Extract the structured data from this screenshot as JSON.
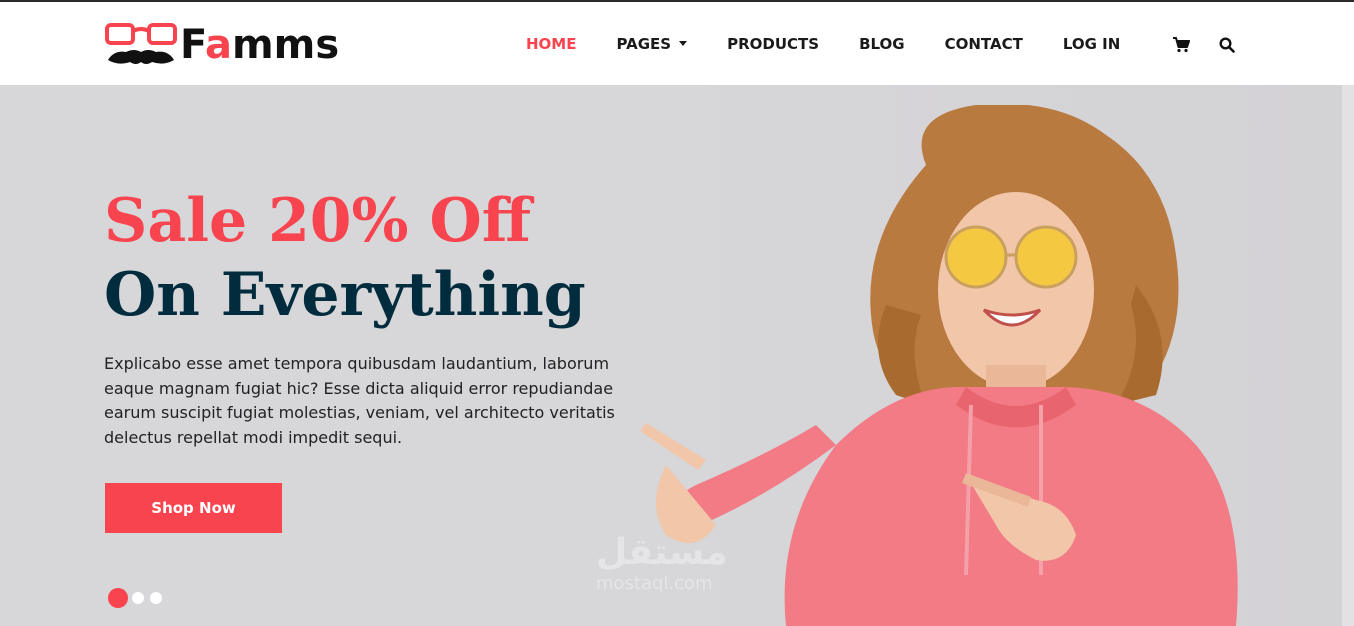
{
  "brand": {
    "name_part1": "F",
    "name_accent": "a",
    "name_part2": "mms",
    "accent_color": "#f7444e",
    "logo_icon": "glasses-mustache-icon"
  },
  "nav": {
    "items": [
      {
        "label": "HOME",
        "active": true
      },
      {
        "label": "PAGES",
        "dropdown": true
      },
      {
        "label": "PRODUCTS"
      },
      {
        "label": "BLOG"
      },
      {
        "label": "CONTACT"
      },
      {
        "label": "LOG IN"
      }
    ],
    "cart_icon": "cart-icon",
    "search_icon": "search-icon"
  },
  "hero": {
    "title_line1": "Sale 20% Off",
    "title_line2": "On Everything",
    "description": "Explicabo esse amet tempora quibusdam laudantium, laborum eaque magnam fugiat hic? Esse dicta aliquid error repudiandae earum suscipit fugiat molestias, veniam, vel architecto veritatis delectus repellat modi impedit sequi.",
    "cta_label": "Shop Now",
    "slides_total": 3,
    "active_slide": 1,
    "title_color": "#f7444e",
    "title2_color": "#002c3e"
  },
  "watermark": {
    "arabic": "مستقل",
    "latin": "mostaql.com"
  }
}
